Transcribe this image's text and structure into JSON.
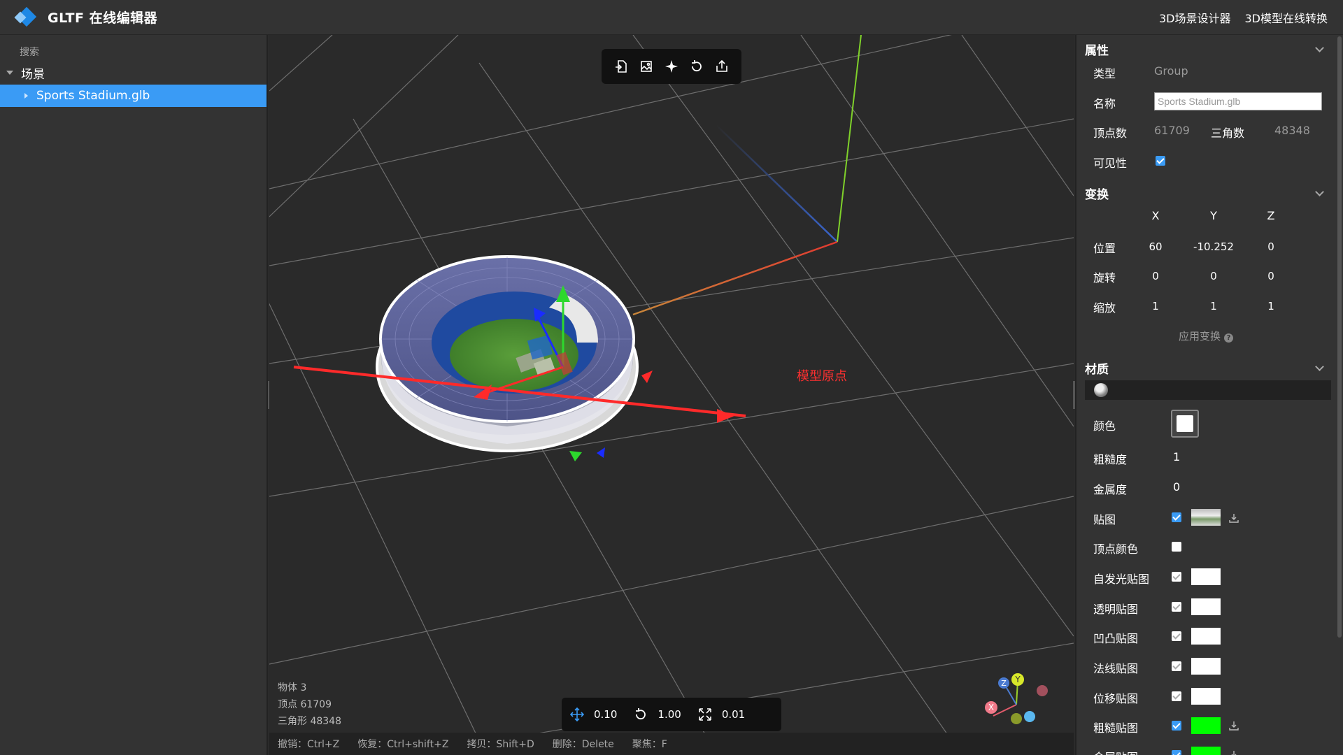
{
  "header": {
    "title": "GLTF 在线编辑器",
    "links": [
      "3D场景设计器",
      "3D模型在线转换"
    ]
  },
  "outliner": {
    "search_placeholder": "搜索",
    "root_label": "场景",
    "items": [
      {
        "label": "Sports Stadium.glb",
        "selected": true
      }
    ]
  },
  "viewport": {
    "origin_label": "模型原点",
    "stats": {
      "objects": "物体 3",
      "vertices": "顶点 61709",
      "triangles": "三角形 48348"
    },
    "snap": {
      "translate": "0.10",
      "rotate": "1.00",
      "scale": "0.01"
    },
    "shortcuts": [
      "撤销：Ctrl+Z",
      "恢复：Ctrl+shift+Z",
      "拷贝：Shift+D",
      "删除：Delete",
      "聚焦：F"
    ],
    "toolbar_icons": [
      "import-icon",
      "import-image-icon",
      "focus-icon",
      "reset-icon",
      "export-icon"
    ],
    "gizmo_labels": {
      "x": "X",
      "y": "Y",
      "z": "Z"
    }
  },
  "properties": {
    "section_title": "属性",
    "type_label": "类型",
    "type_value": "Group",
    "name_label": "名称",
    "name_value": "Sports Stadium.glb",
    "vertices_label": "顶点数",
    "vertices_value": "61709",
    "triangles_label": "三角数",
    "triangles_value": "48348",
    "visible_label": "可见性",
    "visible": true
  },
  "transform": {
    "section_title": "变换",
    "headers": [
      "X",
      "Y",
      "Z"
    ],
    "position_label": "位置",
    "position": [
      "60",
      "-10.252",
      "0"
    ],
    "rotation_label": "旋转",
    "rotation": [
      "0",
      "0",
      "0"
    ],
    "scale_label": "缩放",
    "scale": [
      "1",
      "1",
      "1"
    ],
    "apply_label": "应用变换"
  },
  "material": {
    "section_title": "材质",
    "color_label": "颜色",
    "color": "#ffffff",
    "roughness_label": "粗糙度",
    "roughness": "1",
    "metalness_label": "金属度",
    "metalness": "0",
    "map_label": "贴图",
    "vertex_color_label": "顶点颜色",
    "emissive_map_label": "自发光贴图",
    "alpha_map_label": "透明贴图",
    "bump_map_label": "凹凸贴图",
    "normal_map_label": "法线贴图",
    "displacement_map_label": "位移贴图",
    "roughness_map_label": "粗糙贴图",
    "metalness_map_label": "金属贴图",
    "roughness_map_color": "#00ff00",
    "metalness_map_color": "#00ff00"
  }
}
